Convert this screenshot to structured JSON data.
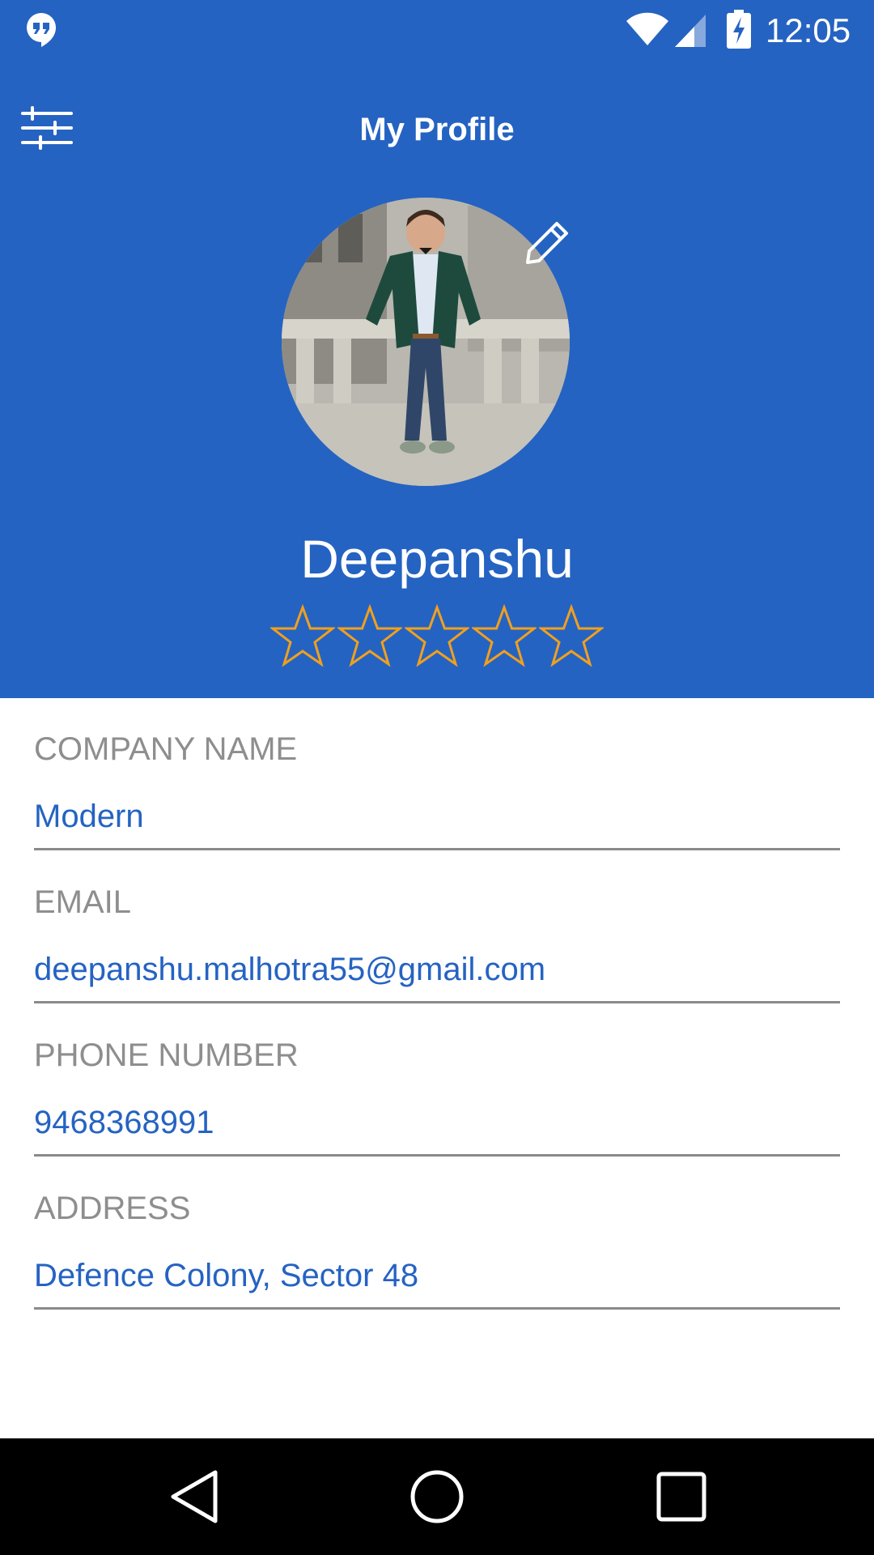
{
  "status_bar": {
    "time": "12:05",
    "icons": [
      "hangouts-icon",
      "wifi-icon",
      "signal-icon",
      "battery-charging-icon"
    ]
  },
  "app_bar": {
    "title": "My Profile",
    "menu_icon": "sliders-icon"
  },
  "profile": {
    "name": "Deepanshu",
    "edit_icon": "pencil-icon",
    "rating": 0,
    "rating_max": 5,
    "star_color": "#f0a01e"
  },
  "fields": {
    "company": {
      "label": "COMPANY NAME",
      "value": "Modern"
    },
    "email": {
      "label": "EMAIL",
      "value": "deepanshu.malhotra55@gmail.com"
    },
    "phone": {
      "label": "PHONE NUMBER",
      "value": "9468368991"
    },
    "address": {
      "label": "ADDRESS",
      "value": "Defence Colony, Sector 48"
    }
  },
  "nav_bar": {
    "icons": [
      "back-icon",
      "home-icon",
      "recents-icon"
    ]
  },
  "colors": {
    "primary": "#2563c2",
    "label_gray": "#8e8e8e",
    "underline": "#8a8a8a"
  }
}
